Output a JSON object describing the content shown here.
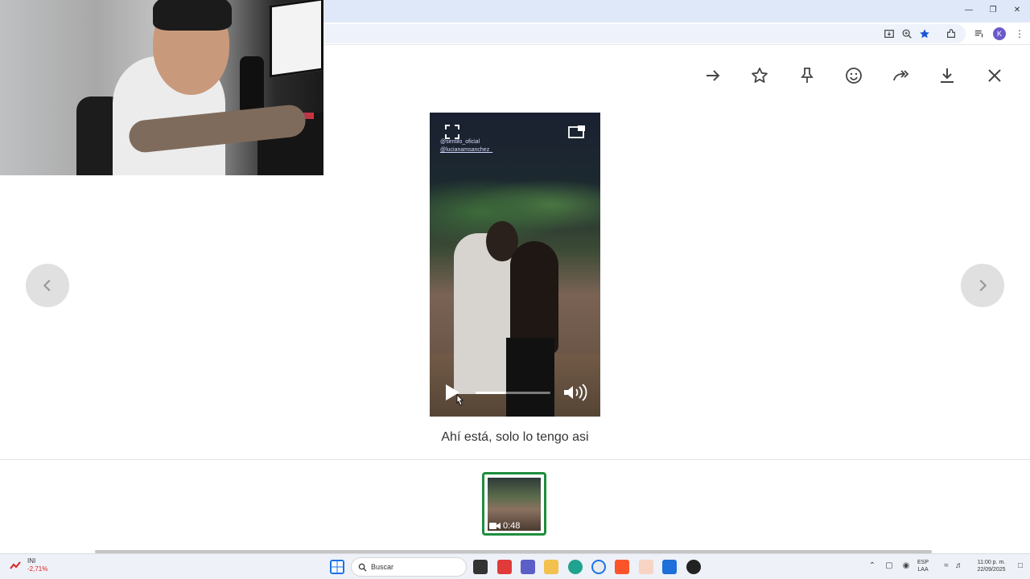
{
  "browser": {
    "window_controls": [
      "minimize",
      "maximize",
      "close"
    ],
    "toolbar_icons": [
      "install-app",
      "zoom",
      "bookmark-star",
      "extensions",
      "media-controls",
      "more-menu"
    ],
    "profile_initial": "K"
  },
  "viewer": {
    "actions": [
      {
        "name": "forward-icon"
      },
      {
        "name": "star-icon"
      },
      {
        "name": "pin-icon"
      },
      {
        "name": "emoji-icon"
      },
      {
        "name": "share-icon"
      },
      {
        "name": "download-icon"
      },
      {
        "name": "close-icon"
      }
    ],
    "video": {
      "credit_line_1": "@sentilo_oficial",
      "credit_line_2": "@lucianamsanchez_",
      "progress": 0.4
    },
    "caption": "Ahí está, solo lo tengo asi",
    "thumbnail": {
      "duration": "0:48"
    }
  },
  "taskbar": {
    "ticker_name": "INI",
    "ticker_change": "-2,71%",
    "search_placeholder": "Buscar",
    "lang_line_1": "ESP",
    "lang_line_2": "LAA",
    "time": "11:00 p. m.",
    "date": "22/09/2025"
  },
  "colors": {
    "accent_green": "#1e8e3e",
    "titlebar": "#dfe8f8",
    "nav_button": "#e0e0e0"
  }
}
